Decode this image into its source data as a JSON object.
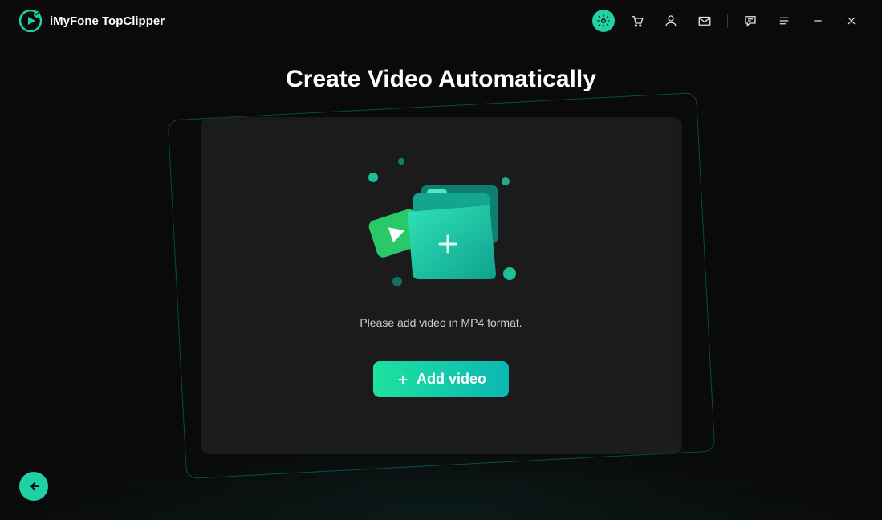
{
  "header": {
    "brand_name": "iMyFone TopClipper",
    "icons": {
      "settings": "settings-icon",
      "cart": "cart-icon",
      "user": "user-icon",
      "mail": "mail-icon",
      "feedback": "feedback-icon",
      "menu": "menu-icon"
    }
  },
  "main": {
    "title": "Create Video Automatically",
    "hint": "Please add video in MP4 format.",
    "add_button_label": "Add video"
  },
  "colors": {
    "accent": "#1fd1a5",
    "accent_gradient_end": "#0bb7b3",
    "bg": "#0a0a0a"
  }
}
